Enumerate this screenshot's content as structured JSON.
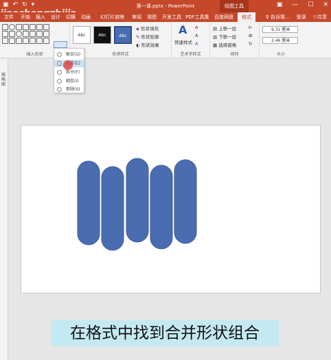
{
  "titlebar": {
    "doc_title": "第一课.pptx - PowerPoint",
    "context_tab": "绘图工具",
    "qat_icons": [
      "save-icon",
      "undo-icon",
      "redo-icon",
      "customize-icon"
    ],
    "window_icons": [
      "ribbon-display-icon",
      "minimize-icon",
      "maximize-icon",
      "close-icon"
    ]
  },
  "watermark": "jiaochengzhijia",
  "tabs": [
    {
      "label": "文件"
    },
    {
      "label": "开始"
    },
    {
      "label": "插入"
    },
    {
      "label": "设计"
    },
    {
      "label": "切换"
    },
    {
      "label": "动画"
    },
    {
      "label": "幻灯片放映"
    },
    {
      "label": "审阅"
    },
    {
      "label": "视图"
    },
    {
      "label": "开发工具"
    },
    {
      "label": "PDF工具集"
    },
    {
      "label": "百度网盘"
    },
    {
      "label": "格式"
    }
  ],
  "tab_right": {
    "tellme": "告诉我...",
    "login": "登录",
    "share": "共享"
  },
  "ribbon": {
    "insert_shapes_label": "插入形状",
    "shape_styles_label": "形状样式",
    "style_swatch_text": "Abc",
    "shape_fill": "形状填充",
    "shape_outline": "形状轮廓",
    "shape_effects": "形状效果",
    "quick_styles": "快速样式",
    "wordart_label": "艺术字样式",
    "bring_forward": "上移一层",
    "send_backward": "下移一层",
    "selection_pane": "选择窗格",
    "arrange_label": "排列",
    "height_value": "9.31 厘米",
    "width_value": "2.46 厘米",
    "size_label": "大小"
  },
  "merge_menu": {
    "items": [
      {
        "label": "联合(U)",
        "icon": "union-icon"
      },
      {
        "label": "组合(C)",
        "icon": "combine-icon"
      },
      {
        "label": "拆分(F)",
        "icon": "fragment-icon"
      },
      {
        "label": "相交(I)",
        "icon": "intersect-icon"
      },
      {
        "label": "剪除(S)",
        "icon": "subtract-icon"
      }
    ],
    "highlighted_index": 1
  },
  "left_pane_label": "缩略图",
  "caption": "在格式中找到合并形状组合",
  "colors": {
    "titlebar": "#c6482a",
    "shape_fill": "#4a6db2",
    "shape_stroke": "#3a5a9a",
    "caption_bg": "#c5e9f2"
  }
}
